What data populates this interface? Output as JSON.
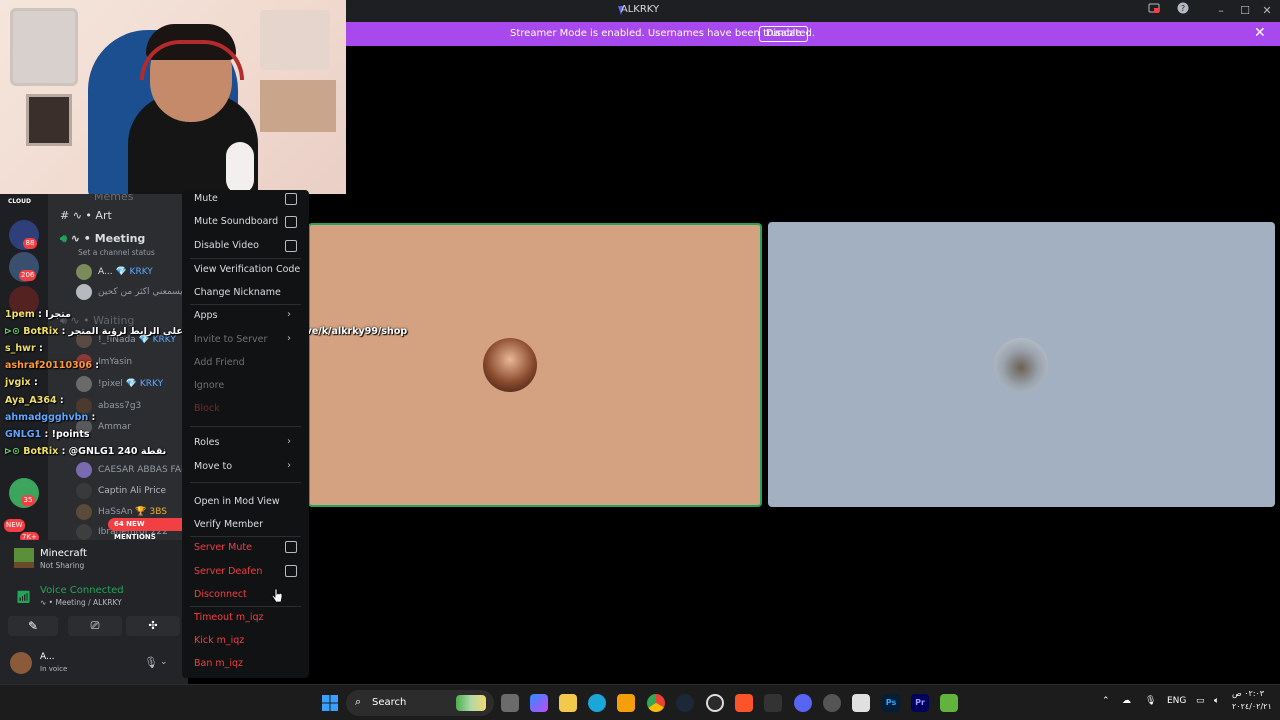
{
  "window": {
    "title": "ALKRKY"
  },
  "banner": {
    "message": "Streamer Mode is enabled. Usernames have been truncated.",
    "disable_label": "Disable"
  },
  "server_badges": [
    "88",
    "206",
    "35",
    "7K+"
  ],
  "server_new_label": "NEW",
  "channels": {
    "cloud_label": "CLOUD",
    "partial_above": "Memes",
    "art": "Art",
    "meeting": "Meeting",
    "meeting_status": "Set a channel status",
    "waiting": "Waiting",
    "mentions_label": "64 NEW MENTIONS"
  },
  "meeting_members": [
    {
      "name": "A...",
      "tag": "KRKY"
    },
    {
      "name": "سالار يسمعني اكثر من كحين",
      "tag": ""
    }
  ],
  "waiting_members": [
    {
      "name": "!_!iNada",
      "tag": "KRKY"
    },
    {
      "name": "ImYasin",
      "tag": ""
    },
    {
      "name": "!pixel",
      "tag": "KRKY"
    },
    {
      "name": "abass7g3",
      "tag": ""
    },
    {
      "name": "Ammar",
      "tag": ""
    },
    {
      "name": "CAESAR ABBAS FAL",
      "tag": ""
    },
    {
      "name": "Captin Ali Price",
      "tag": ""
    },
    {
      "name": "HaSsAn",
      "tag": "3BS"
    },
    {
      "name": "Ibrahemrof",
      "tag": "222"
    }
  ],
  "chat_overlay": [
    {
      "user": "1pem",
      "text": ": متجرا"
    },
    {
      "user": "BotRix",
      "text": ": اضغط على الرابط لرؤية المتجر : https://botrix.live/k/alkrky99/shop"
    },
    {
      "user": "s_hwr",
      "text": ":"
    },
    {
      "user": "ashraf20110306",
      "text": ":"
    },
    {
      "user": "jvgix",
      "text": ":"
    },
    {
      "user": "Aya_A364",
      "text": ":"
    },
    {
      "user": "ahmadggghvbn",
      "text": ":"
    },
    {
      "user": "GNLG1",
      "text": ": !points"
    },
    {
      "user": "BotRix",
      "text": ": @GNLG1 240 نقطة"
    }
  ],
  "activity": {
    "game": "Minecraft",
    "status": "Not Sharing"
  },
  "voice": {
    "title": "Voice Connected",
    "location": "Meeting / ALKRKY"
  },
  "user": {
    "name": "A...",
    "status": "In voice"
  },
  "context_menu": {
    "mute": "Mute",
    "mute_soundboard": "Mute Soundboard",
    "disable_video": "Disable Video",
    "view_verification": "View Verification Code",
    "change_nickname": "Change Nickname",
    "apps": "Apps",
    "invite": "Invite to Server",
    "add_friend": "Add Friend",
    "ignore": "Ignore",
    "block": "Block",
    "roles": "Roles",
    "move_to": "Move to",
    "open_mod_view": "Open in Mod View",
    "verify_member": "Verify Member",
    "server_mute": "Server Mute",
    "server_deafen": "Server Deafen",
    "disconnect": "Disconnect",
    "timeout": "Timeout m_iqz",
    "kick": "Kick m_iqz",
    "ban": "Ban m_iqz"
  },
  "taskbar": {
    "search_label": "Search",
    "lang": "ENG",
    "time": "٠٢:٠٣ ص",
    "date": "٢٠٢٤/٠٢/٢١"
  },
  "colors": {
    "banner": "#a849ee",
    "speaking_border": "#23a559",
    "danger": "#f23f43",
    "tile1_bg": "#d4a280",
    "tile2_bg": "#a3b0c1"
  }
}
